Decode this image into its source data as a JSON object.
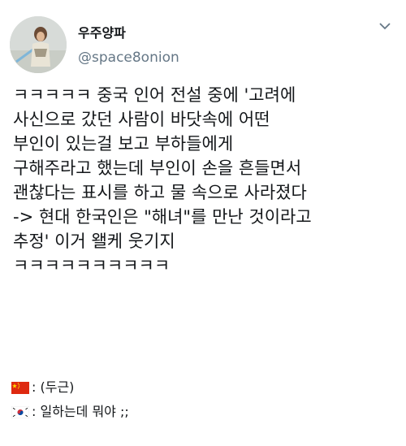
{
  "user": {
    "display_name": "우주양파",
    "handle": "@space8onion"
  },
  "tweet": {
    "text": "ㅋㅋㅋㅋㅋ 중국 인어 전설 중에 '고려에\n사신으로 갔던 사람이 바닷속에 어떤\n부인이 있는걸 보고 부하들에게\n구해주라고 했는데 부인이 손을 흔들면서\n괜찮다는 표시를 하고 물 속으로 사라졌다\n-> 현대 한국인은 \"해녀\"를 만난 것이라고\n추정' 이거 왤케 웃기지\nㅋㅋㅋㅋㅋㅋㅋㅋㅋㅋ"
  },
  "replies": [
    {
      "flag_icon": "china-flag-icon",
      "text": ": (두근)"
    },
    {
      "flag_icon": "korea-flag-icon",
      "text": ": 일하는데 뭐야 ;;"
    }
  ],
  "colors": {
    "text": "#14171a",
    "secondary": "#657786",
    "china_red": "#de2910",
    "china_yellow": "#ffde00",
    "korea_red": "#cd2e3a",
    "korea_blue": "#0047a0"
  }
}
